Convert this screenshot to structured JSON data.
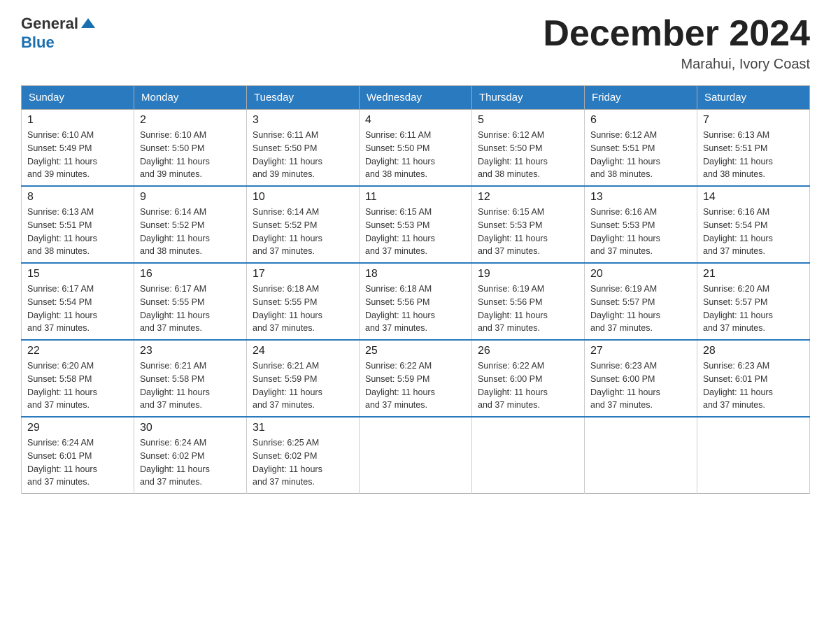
{
  "header": {
    "logo": {
      "text_general": "General",
      "text_blue": "Blue",
      "arrow_color": "#1a6faf"
    },
    "title": "December 2024",
    "location": "Marahui, Ivory Coast"
  },
  "days_of_week": [
    "Sunday",
    "Monday",
    "Tuesday",
    "Wednesday",
    "Thursday",
    "Friday",
    "Saturday"
  ],
  "weeks": [
    {
      "days": [
        {
          "number": "1",
          "sunrise": "6:10 AM",
          "sunset": "5:49 PM",
          "daylight": "11 hours and 39 minutes."
        },
        {
          "number": "2",
          "sunrise": "6:10 AM",
          "sunset": "5:50 PM",
          "daylight": "11 hours and 39 minutes."
        },
        {
          "number": "3",
          "sunrise": "6:11 AM",
          "sunset": "5:50 PM",
          "daylight": "11 hours and 39 minutes."
        },
        {
          "number": "4",
          "sunrise": "6:11 AM",
          "sunset": "5:50 PM",
          "daylight": "11 hours and 38 minutes."
        },
        {
          "number": "5",
          "sunrise": "6:12 AM",
          "sunset": "5:50 PM",
          "daylight": "11 hours and 38 minutes."
        },
        {
          "number": "6",
          "sunrise": "6:12 AM",
          "sunset": "5:51 PM",
          "daylight": "11 hours and 38 minutes."
        },
        {
          "number": "7",
          "sunrise": "6:13 AM",
          "sunset": "5:51 PM",
          "daylight": "11 hours and 38 minutes."
        }
      ]
    },
    {
      "days": [
        {
          "number": "8",
          "sunrise": "6:13 AM",
          "sunset": "5:51 PM",
          "daylight": "11 hours and 38 minutes."
        },
        {
          "number": "9",
          "sunrise": "6:14 AM",
          "sunset": "5:52 PM",
          "daylight": "11 hours and 38 minutes."
        },
        {
          "number": "10",
          "sunrise": "6:14 AM",
          "sunset": "5:52 PM",
          "daylight": "11 hours and 37 minutes."
        },
        {
          "number": "11",
          "sunrise": "6:15 AM",
          "sunset": "5:53 PM",
          "daylight": "11 hours and 37 minutes."
        },
        {
          "number": "12",
          "sunrise": "6:15 AM",
          "sunset": "5:53 PM",
          "daylight": "11 hours and 37 minutes."
        },
        {
          "number": "13",
          "sunrise": "6:16 AM",
          "sunset": "5:53 PM",
          "daylight": "11 hours and 37 minutes."
        },
        {
          "number": "14",
          "sunrise": "6:16 AM",
          "sunset": "5:54 PM",
          "daylight": "11 hours and 37 minutes."
        }
      ]
    },
    {
      "days": [
        {
          "number": "15",
          "sunrise": "6:17 AM",
          "sunset": "5:54 PM",
          "daylight": "11 hours and 37 minutes."
        },
        {
          "number": "16",
          "sunrise": "6:17 AM",
          "sunset": "5:55 PM",
          "daylight": "11 hours and 37 minutes."
        },
        {
          "number": "17",
          "sunrise": "6:18 AM",
          "sunset": "5:55 PM",
          "daylight": "11 hours and 37 minutes."
        },
        {
          "number": "18",
          "sunrise": "6:18 AM",
          "sunset": "5:56 PM",
          "daylight": "11 hours and 37 minutes."
        },
        {
          "number": "19",
          "sunrise": "6:19 AM",
          "sunset": "5:56 PM",
          "daylight": "11 hours and 37 minutes."
        },
        {
          "number": "20",
          "sunrise": "6:19 AM",
          "sunset": "5:57 PM",
          "daylight": "11 hours and 37 minutes."
        },
        {
          "number": "21",
          "sunrise": "6:20 AM",
          "sunset": "5:57 PM",
          "daylight": "11 hours and 37 minutes."
        }
      ]
    },
    {
      "days": [
        {
          "number": "22",
          "sunrise": "6:20 AM",
          "sunset": "5:58 PM",
          "daylight": "11 hours and 37 minutes."
        },
        {
          "number": "23",
          "sunrise": "6:21 AM",
          "sunset": "5:58 PM",
          "daylight": "11 hours and 37 minutes."
        },
        {
          "number": "24",
          "sunrise": "6:21 AM",
          "sunset": "5:59 PM",
          "daylight": "11 hours and 37 minutes."
        },
        {
          "number": "25",
          "sunrise": "6:22 AM",
          "sunset": "5:59 PM",
          "daylight": "11 hours and 37 minutes."
        },
        {
          "number": "26",
          "sunrise": "6:22 AM",
          "sunset": "6:00 PM",
          "daylight": "11 hours and 37 minutes."
        },
        {
          "number": "27",
          "sunrise": "6:23 AM",
          "sunset": "6:00 PM",
          "daylight": "11 hours and 37 minutes."
        },
        {
          "number": "28",
          "sunrise": "6:23 AM",
          "sunset": "6:01 PM",
          "daylight": "11 hours and 37 minutes."
        }
      ]
    },
    {
      "days": [
        {
          "number": "29",
          "sunrise": "6:24 AM",
          "sunset": "6:01 PM",
          "daylight": "11 hours and 37 minutes."
        },
        {
          "number": "30",
          "sunrise": "6:24 AM",
          "sunset": "6:02 PM",
          "daylight": "11 hours and 37 minutes."
        },
        {
          "number": "31",
          "sunrise": "6:25 AM",
          "sunset": "6:02 PM",
          "daylight": "11 hours and 37 minutes."
        },
        null,
        null,
        null,
        null
      ]
    }
  ],
  "labels": {
    "sunrise": "Sunrise:",
    "sunset": "Sunset:",
    "daylight": "Daylight:"
  }
}
